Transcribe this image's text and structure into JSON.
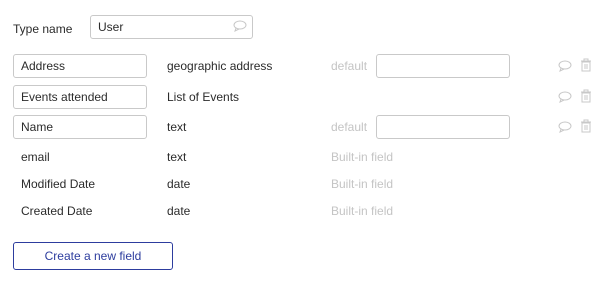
{
  "type_name": {
    "label": "Type name",
    "value": "User"
  },
  "fields": [
    {
      "name": "Address",
      "type": "geographic address",
      "default_label": "default",
      "default_value": ""
    },
    {
      "name": "Events attended",
      "type": "List of Events"
    },
    {
      "name": "Name",
      "type": "text",
      "default_label": "default",
      "default_value": ""
    },
    {
      "name": "email",
      "type": "text",
      "builtin_label": "Built-in field"
    },
    {
      "name": "Modified Date",
      "type": "date",
      "builtin_label": "Built-in field"
    },
    {
      "name": "Created Date",
      "type": "date",
      "builtin_label": "Built-in field"
    }
  ],
  "create_button": {
    "label": "Create a new field"
  },
  "icons": {
    "comment": "comment-bubble-icon",
    "delete": "trash-icon"
  },
  "colors": {
    "accent": "#2d3d9e",
    "muted_text": "#c4c4c4",
    "border": "#c9c9c9",
    "icon": "#c8c8c8"
  }
}
